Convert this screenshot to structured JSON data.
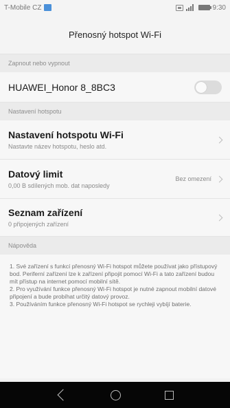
{
  "status_bar": {
    "carrier": "T-Mobile CZ",
    "time": "9:30"
  },
  "header": {
    "title": "Přenosný hotspot Wi-Fi"
  },
  "sections": {
    "toggle_header": "Zapnout nebo vypnout",
    "settings_header": "Nastavení hotspotu",
    "help_header": "Nápověda"
  },
  "hotspot": {
    "name": "HUAWEI_Honor 8_8BC3",
    "enabled": false
  },
  "settings": {
    "wifi_title": "Nastavení hotspotu Wi-Fi",
    "wifi_sub": "Nastavte název hotspotu, heslo atd.",
    "data_title": "Datový limit",
    "data_sub": "0,00 B sdílených mob. dat naposledy",
    "data_value": "Bez omezení",
    "devices_title": "Seznam zařízení",
    "devices_sub": "0 připojených zařízení"
  },
  "help": {
    "line1": "1. Své zařízení s funkcí přenosný Wi-Fi hotspot můžete používat jako přístupový bod. Periferní zařízení lze k zařízení připojit pomocí Wi-Fi a tato zařízení budou mít přístup na internet pomocí mobilní sítě.",
    "line2": "2. Pro využívání funkce přenosný Wi-Fi hotspot je nutné zapnout mobilní datové připojení a bude probíhat určitý datový provoz.",
    "line3": "3. Používáním funkce přenosný Wi-Fi hotspot se rychleji vybíjí baterie."
  },
  "icons": {
    "status": [
      "photo-icon",
      "sim-icon",
      "signal-icon",
      "battery-icon"
    ],
    "nav": [
      "back-icon",
      "home-icon",
      "recent-apps-icon"
    ]
  }
}
